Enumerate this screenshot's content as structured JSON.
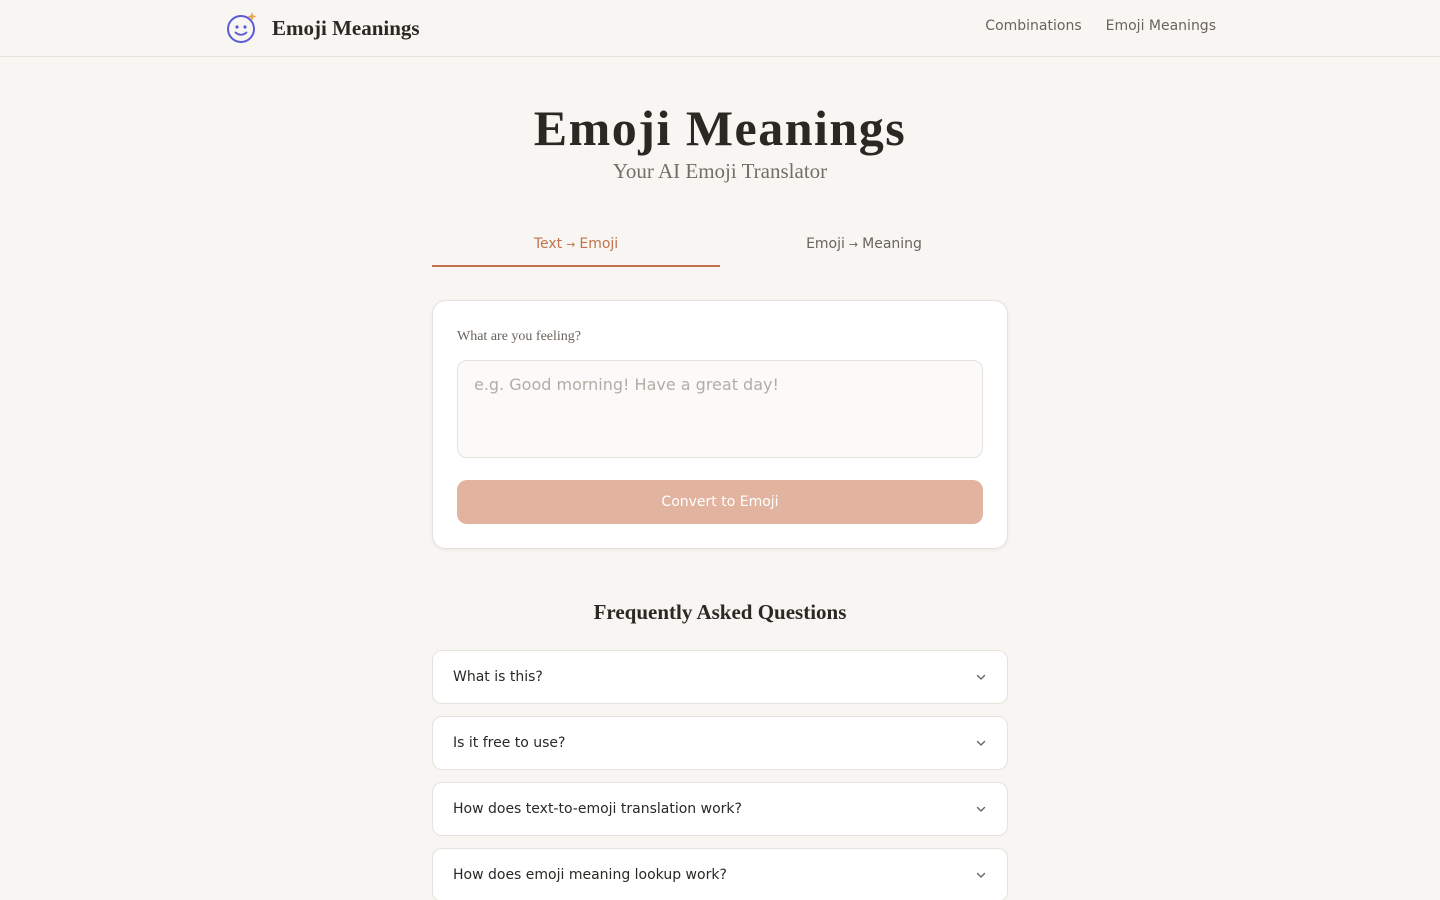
{
  "header": {
    "brand_name": "Emoji Meanings",
    "logo_icon": "smiley-sparkle-icon",
    "nav": [
      {
        "label": "Combinations"
      },
      {
        "label": "Emoji Meanings"
      }
    ]
  },
  "hero": {
    "title": "Emoji Meanings",
    "subtitle": "Your AI Emoji Translator"
  },
  "tabs": [
    {
      "from": "Text",
      "arrow": "→",
      "to": "Emoji",
      "active": true
    },
    {
      "from": "Emoji",
      "arrow": "→",
      "to": "Meaning",
      "active": false
    }
  ],
  "converter": {
    "label": "What are you feeling?",
    "placeholder": "e.g. Good morning! Have a great day!",
    "value": "",
    "button_label": "Convert to Emoji"
  },
  "faq": {
    "title": "Frequently Asked Questions",
    "items": [
      {
        "question": "What is this?"
      },
      {
        "question": "Is it free to use?"
      },
      {
        "question": "How does text-to-emoji translation work?"
      },
      {
        "question": "How does emoji meaning lookup work?"
      }
    ]
  },
  "colors": {
    "accent": "#c0734d",
    "button_disabled": "#e2b4a0",
    "background": "#f8f6f2",
    "logo_stroke": "#5b5bd6",
    "logo_spark": "#f0a14a"
  }
}
